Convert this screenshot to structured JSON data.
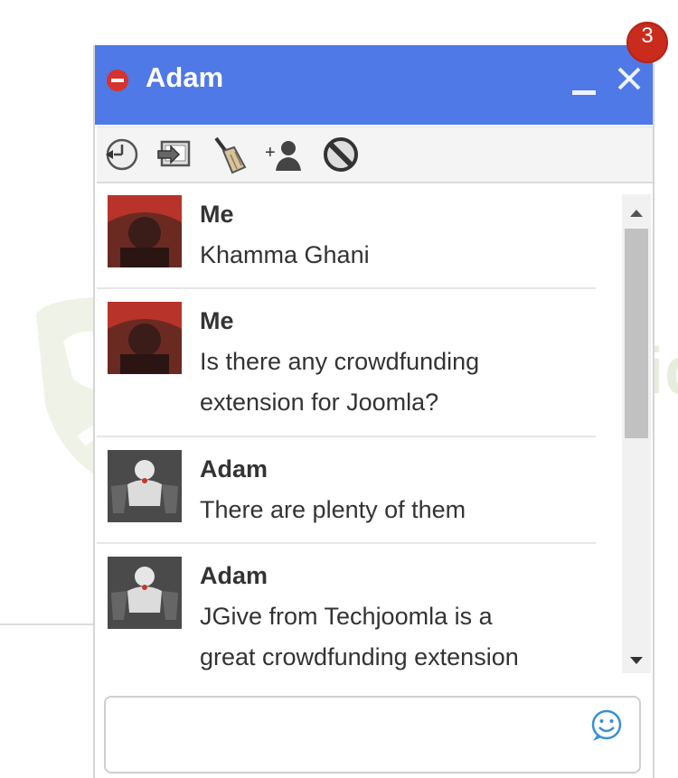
{
  "chat": {
    "title": "Adam",
    "unread_count": "3"
  },
  "toolbar": {
    "icons": [
      "history-icon",
      "screen-share-icon",
      "clear-broom-icon",
      "add-user-icon",
      "block-icon"
    ]
  },
  "messages": [
    {
      "sender": "Me",
      "lines": [
        "Khamma Ghani"
      ]
    },
    {
      "sender": "Me",
      "lines": [
        "Is there any crowdfunding",
        "extension for Joomla?"
      ]
    },
    {
      "sender": "Adam",
      "lines": [
        "There are plenty of them"
      ]
    },
    {
      "sender": "Adam",
      "lines": [
        "JGive from Techjoomla is a",
        "great crowdfunding extension"
      ]
    }
  ],
  "composer": {
    "value": "",
    "placeholder": ""
  },
  "watermark": {
    "text": "Joomla.bid"
  },
  "colors": {
    "header": "#4f79e6",
    "badge": "#c92b1d",
    "status": "#d8322c"
  }
}
